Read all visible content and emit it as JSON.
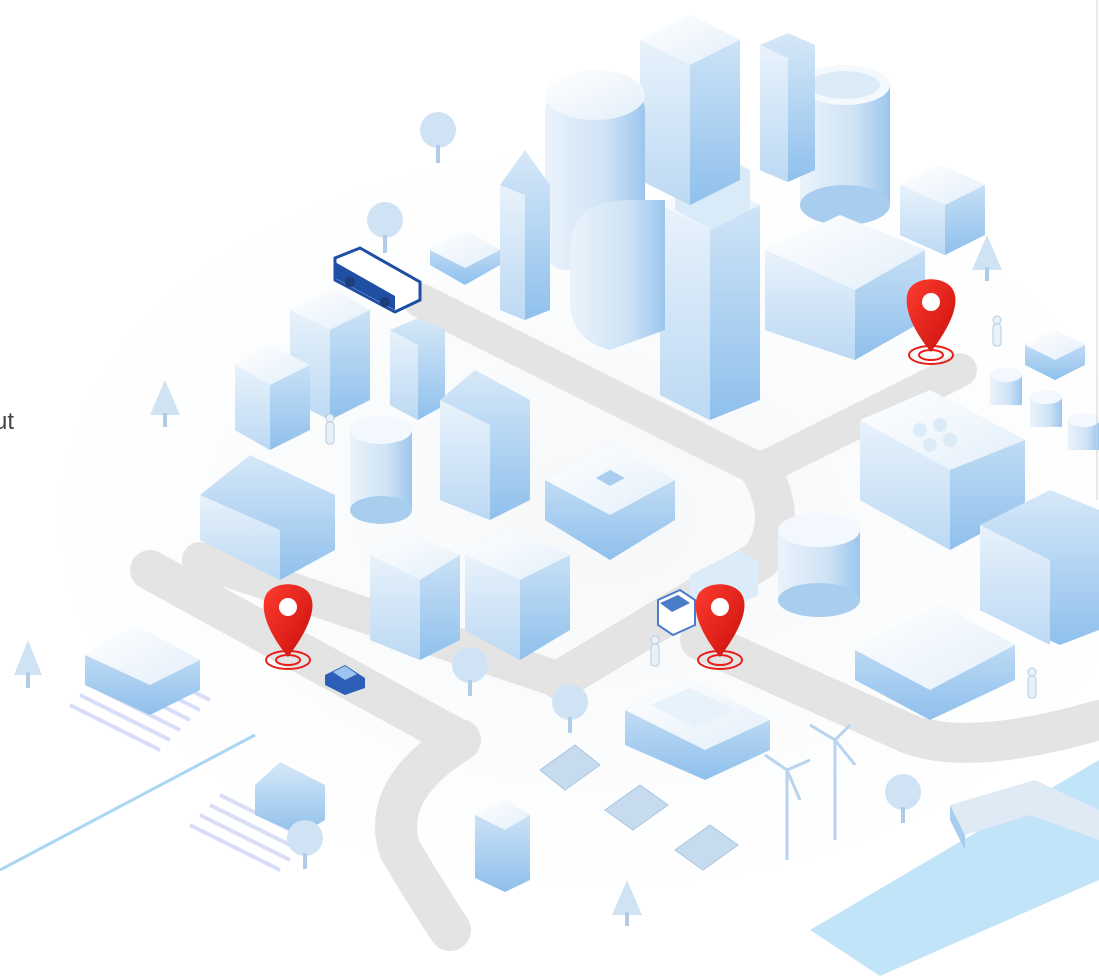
{
  "edge_text": "ut",
  "colors": {
    "building_light": "#eef5fc",
    "building_mid": "#cfe3f5",
    "building_dark": "#a9cdef",
    "road": "#e6e6e6",
    "water": "#bfe2f8",
    "pin_red": "#e81e18",
    "bus_blue": "#1f4fa3"
  },
  "icons": [
    "map-pin-icon",
    "bus-icon",
    "car-icon",
    "truck-icon",
    "wind-turbine-icon",
    "solar-panel-icon",
    "tree-icon",
    "person-icon"
  ]
}
